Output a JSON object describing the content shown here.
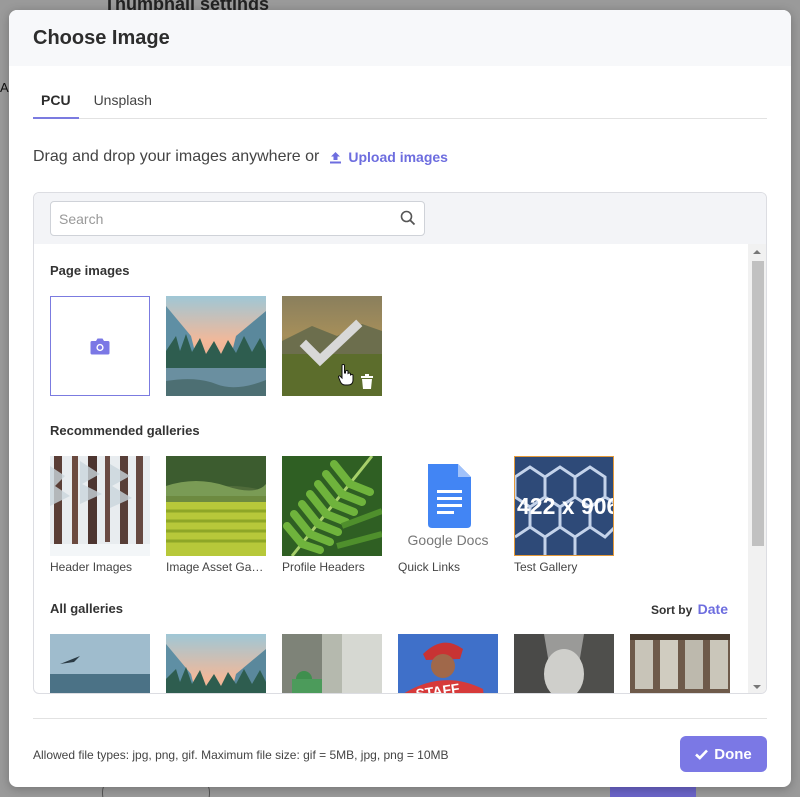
{
  "background": {
    "title": "Thumbnail settings",
    "side_letter": "A"
  },
  "modal": {
    "title": "Choose Image",
    "tabs": [
      {
        "label": "PCU",
        "active": true
      },
      {
        "label": "Unsplash",
        "active": false
      }
    ],
    "drag_text": "Drag and drop your images anywhere or",
    "upload_label": "Upload images",
    "search_placeholder": "Search",
    "sections": {
      "page_images": "Page images",
      "recommended": "Recommended galleries",
      "all": "All galleries"
    },
    "recommended_galleries": [
      {
        "label": "Header Images",
        "icon": "snowy-forest"
      },
      {
        "label": "Image Asset Gallery",
        "icon": "green-fields"
      },
      {
        "label": "Profile Headers",
        "icon": "fern"
      },
      {
        "label": "Quick Links",
        "icon": "google-docs"
      },
      {
        "label": "Test Gallery",
        "icon": "hex-mesh"
      }
    ],
    "google_docs_text": "Google Docs",
    "test_gallery_overlay": "422 x 906",
    "sort_by_label": "Sort by",
    "sort_by_value": "Date",
    "footer_note": "Allowed file types: jpg, png, gif. Maximum file size: gif = 5MB, jpg, png = 10MB",
    "done_label": "Done",
    "accent_color": "#7b78e5"
  }
}
